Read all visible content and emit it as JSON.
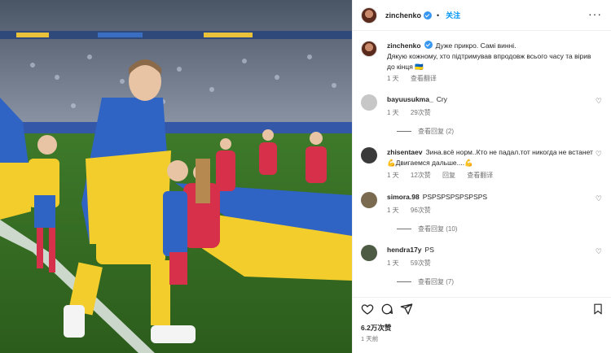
{
  "post": {
    "username": "zinchenko",
    "follow_label": "关注",
    "dot": "•",
    "caption_line1": "Дуже прикро. Самі винні.",
    "caption_line2": "Дякую кожному, хто підтримував впродовж всього часу та вірив до кінця 🇺🇦",
    "caption_time": "1 天",
    "caption_translate": "查看翻译"
  },
  "comments": [
    {
      "user": "bayuusukma_",
      "text": "Cry",
      "time": "1 天",
      "likes": "29次赞",
      "reply": "",
      "replies": "查看回复 (2)",
      "avatar_color": "#c7c7c7"
    },
    {
      "user": "zhisentaev",
      "text": "Зина.всё норм..Кто не падал.тот никогда не встанет💪Двигаемся дальше....💪",
      "time": "1 天",
      "likes": "12次赞",
      "reply": "回复",
      "translate": "查看翻译",
      "avatar_color": "#3a3a3a"
    },
    {
      "user": "simora.98",
      "text": "PSPSPSPSPSPSPS",
      "time": "1 天",
      "likes": "96次赞",
      "reply": "",
      "replies": "查看回复 (10)",
      "avatar_color": "#7a6a50"
    },
    {
      "user": "hendra17y",
      "text": "PS",
      "time": "1 天",
      "likes": "59次赞",
      "reply": "",
      "replies": "查看回复 (7)",
      "avatar_color": "#4d5a44"
    }
  ],
  "footer": {
    "likes": "6.2万次赞",
    "time": "1 天前"
  },
  "icons": [
    "more-icon",
    "heart-icon",
    "comment-icon",
    "share-icon",
    "bookmark-icon",
    "verified-icon"
  ],
  "colors": {
    "accent": "#0095f6",
    "verified": "#3897f0",
    "muted": "#737373"
  }
}
